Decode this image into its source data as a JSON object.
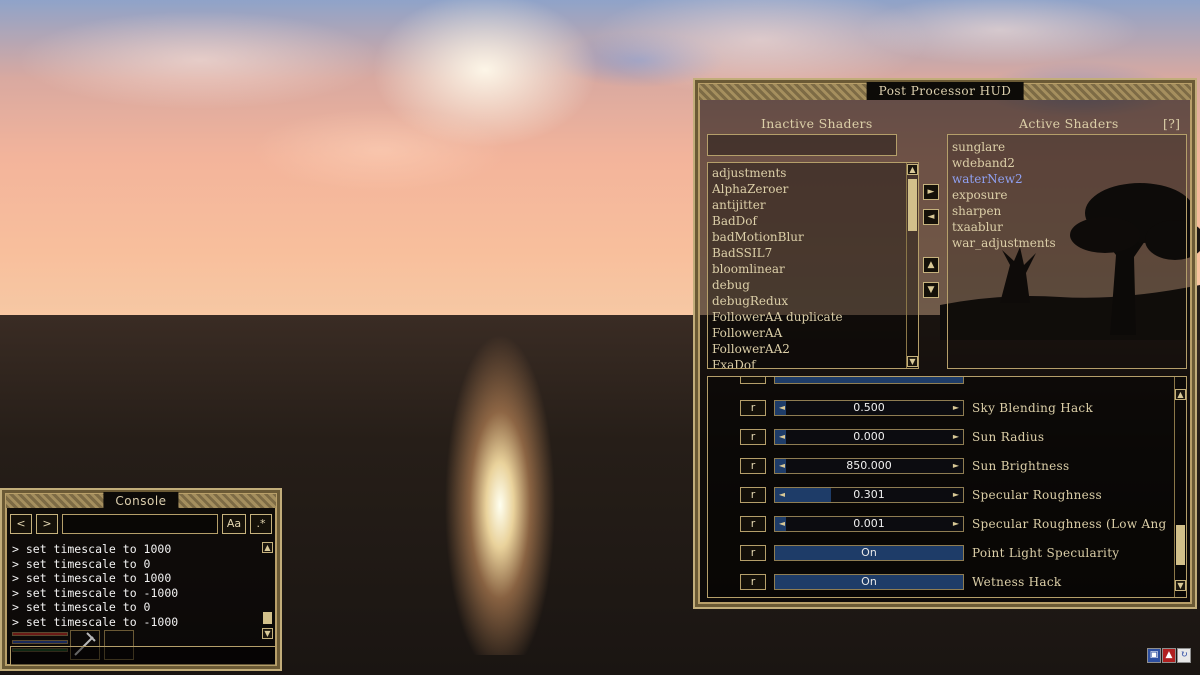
{
  "hud": {
    "title": "Post Processor HUD",
    "inactive_label": "Inactive Shaders",
    "active_label": "Active Shaders",
    "help_label": "[?]",
    "search_value": "",
    "inactive_shaders": [
      "adjustments",
      "AlphaZeroer",
      "antijitter",
      "BadDof",
      "badMotionBlur",
      "BadSSIL7",
      "bloomlinear",
      "debug",
      "debugRedux",
      "FollowerAA duplicate",
      "FollowerAA",
      "FollowerAA2",
      "FxaDof"
    ],
    "active_shaders": [
      "sunglare",
      "wdeband2",
      "waterNew2",
      "exposure",
      "sharpen",
      "txaablur",
      "war_adjustments"
    ],
    "selected_active": "waterNew2",
    "params": [
      {
        "label": "Sky Blending Hack",
        "value": "0.500",
        "fill": 0.0,
        "kind": "slider"
      },
      {
        "label": "Sun Radius",
        "value": "0.000",
        "fill": 0.0,
        "kind": "slider"
      },
      {
        "label": "Sun Brightness",
        "value": "850.000",
        "fill": 0.05,
        "kind": "slider"
      },
      {
        "label": "Specular Roughness",
        "value": "0.301",
        "fill": 0.3,
        "kind": "slider"
      },
      {
        "label": "Specular Roughness (Low Ang",
        "value": "0.001",
        "fill": 0.0,
        "kind": "slider"
      },
      {
        "label": "Point Light Specularity",
        "value": "On",
        "kind": "toggle"
      },
      {
        "label": "Wetness Hack",
        "value": "On",
        "kind": "toggle"
      }
    ],
    "reset_label": "r"
  },
  "console": {
    "title": "Console",
    "prev_label": "<",
    "next_label": ">",
    "input_value": "",
    "case_label": "Aa",
    "regex_label": ".*",
    "lines": [
      "> set timescale to 1000",
      "> set timescale to 0",
      "> set timescale to 1000",
      "> set timescale to -1000",
      "> set timescale to 0",
      "> set timescale to -1000"
    ]
  },
  "colors": {
    "accent_gold": "#c2ad7a",
    "slider_blue": "#1e3c68",
    "selected_text": "#8fa0f0"
  },
  "icons": [
    "arrow-right-icon",
    "arrow-left-icon",
    "arrow-up-icon",
    "arrow-down-icon",
    "weapon-icon",
    "tray-icons"
  ]
}
